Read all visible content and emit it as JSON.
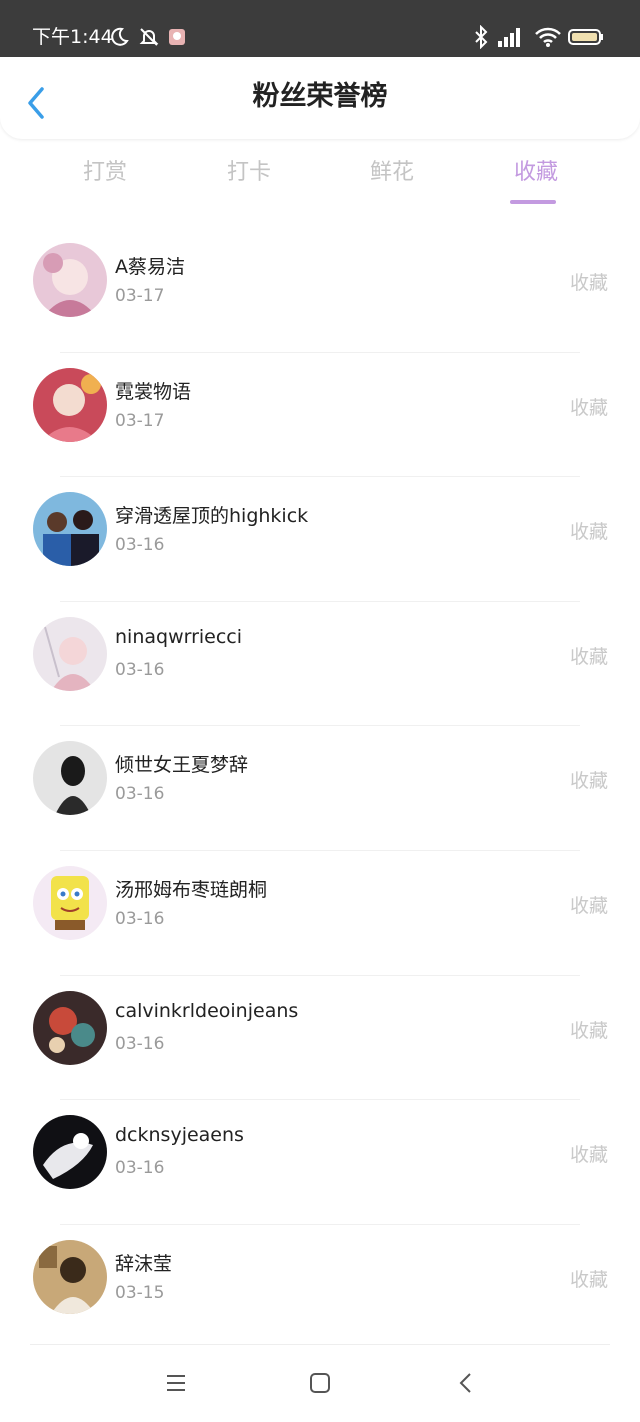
{
  "status_bar": {
    "time": "下午1:44"
  },
  "header": {
    "title": "粉丝荣誉榜"
  },
  "tabs": [
    {
      "label": "打赏",
      "active": false
    },
    {
      "label": "打卡",
      "active": false
    },
    {
      "label": "鲜花",
      "active": false
    },
    {
      "label": "收藏",
      "active": true
    }
  ],
  "colors": {
    "accent": "#c39ae0",
    "back_arrow": "#3a9ee8",
    "inactive_tab": "#c4c4c4"
  },
  "list": [
    {
      "name": "A蔡易洁",
      "date": "03-17",
      "action": "收藏"
    },
    {
      "name": "霓裳物语",
      "date": "03-17",
      "action": "收藏"
    },
    {
      "name": "穿滑透屋顶的highkick",
      "date": "03-16",
      "action": "收藏"
    },
    {
      "name": "ninaqwrriecci",
      "date": "03-16",
      "action": "收藏"
    },
    {
      "name": "倾世女王夏梦辞",
      "date": "03-16",
      "action": "收藏"
    },
    {
      "name": "汤邢姆布枣琏朗桐",
      "date": "03-16",
      "action": "收藏"
    },
    {
      "name": "calvinkrldeoinjeans",
      "date": "03-16",
      "action": "收藏"
    },
    {
      "name": "dcknsyjeaens",
      "date": "03-16",
      "action": "收藏"
    },
    {
      "name": "辞沫莹",
      "date": "03-15",
      "action": "收藏"
    }
  ]
}
